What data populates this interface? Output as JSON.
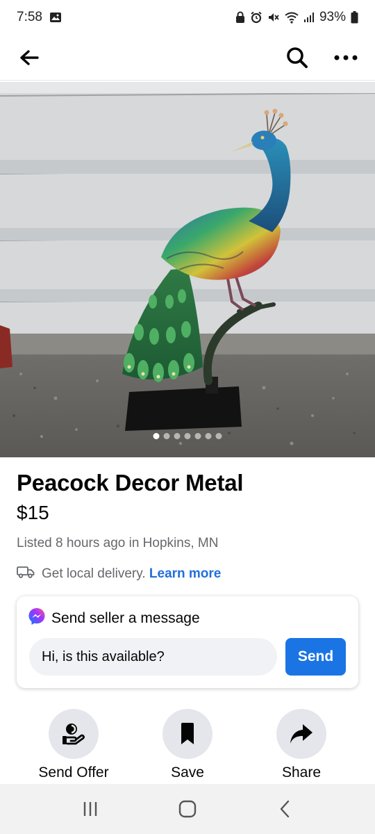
{
  "status_bar": {
    "time": "7:58",
    "battery": "93%",
    "icons": [
      "gallery-icon",
      "lock-icon",
      "alarm-icon",
      "mute-icon",
      "wifi-icon",
      "signal-icon",
      "battery-icon"
    ]
  },
  "header": {
    "icons": [
      "back-arrow-icon",
      "search-icon",
      "more-icon"
    ]
  },
  "photo": {
    "subject": "peacock figurine",
    "dot_count": 7,
    "active_dot": 0
  },
  "listing": {
    "title": "Peacock Decor Metal",
    "price": "$15",
    "listed": "Listed 8 hours ago in Hopkins, MN",
    "delivery_text": "Get local delivery.",
    "learn_more": "Learn more"
  },
  "message": {
    "heading": "Send seller a message",
    "input_value": "Hi, is this available?",
    "send_label": "Send"
  },
  "actions": [
    {
      "label": "Send Offer",
      "icon": "offer-hand-icon"
    },
    {
      "label": "Save",
      "icon": "bookmark-icon"
    },
    {
      "label": "Share",
      "icon": "share-arrow-icon"
    }
  ],
  "colors": {
    "accent": "#1b74e4",
    "link": "#216fdb",
    "muted_text": "#65676b",
    "circle_bg": "#e4e6eb"
  }
}
